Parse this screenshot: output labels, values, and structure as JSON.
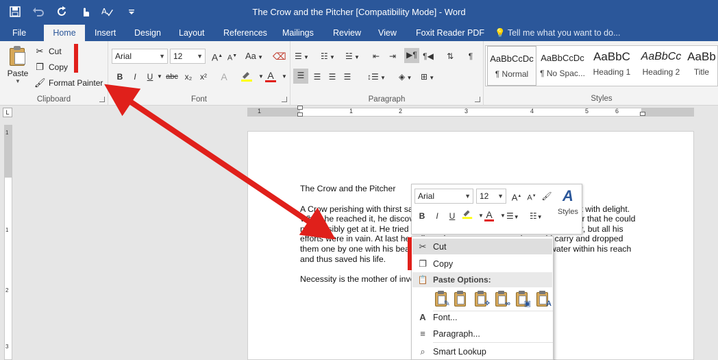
{
  "window": {
    "title": "The Crow and the Pitcher [Compatibility Mode] - Word"
  },
  "qat": {
    "save_icon": "save-icon",
    "undo_icon": "undo-icon",
    "redo_icon": "redo-icon",
    "touch_icon": "touch-mode-icon",
    "spelling_icon": "spelling-icon",
    "customize_icon": "customize-icon"
  },
  "tabs": [
    {
      "label": "File"
    },
    {
      "label": "Home"
    },
    {
      "label": "Insert"
    },
    {
      "label": "Design"
    },
    {
      "label": "Layout"
    },
    {
      "label": "References"
    },
    {
      "label": "Mailings"
    },
    {
      "label": "Review"
    },
    {
      "label": "View"
    },
    {
      "label": "Foxit Reader PDF"
    }
  ],
  "tell_me": "Tell me what you want to do...",
  "clipboard": {
    "paste": "Paste",
    "cut": "Cut",
    "copy": "Copy",
    "format_painter": "Format Painter",
    "label": "Clipboard"
  },
  "font": {
    "name": "Arial",
    "size": "12",
    "grow": "A",
    "shrink": "A",
    "case": "Aa",
    "bold": "B",
    "italic": "I",
    "underline": "U",
    "strike": "abc",
    "subscript": "x₂",
    "superscript": "x²",
    "effects": "A",
    "font_color": "A",
    "label": "Font"
  },
  "paragraph": {
    "label": "Paragraph",
    "pilcrow": "¶"
  },
  "styles": {
    "label": "Styles",
    "items": [
      {
        "preview": "AaBbCcDc",
        "name": "¶ Normal"
      },
      {
        "preview": "AaBbCcDc",
        "name": "¶ No Spac..."
      },
      {
        "preview": "AaBbC",
        "name": "Heading 1"
      },
      {
        "preview": "AaBbCc",
        "name": "Heading 2"
      },
      {
        "preview": "AaBb",
        "name": "Title"
      }
    ]
  },
  "ruler": {
    "numbers": [
      "1",
      "1",
      "2",
      "3",
      "4",
      "5",
      "6"
    ],
    "vnumbers": [
      "1",
      "1",
      "2",
      "3"
    ]
  },
  "document": {
    "title": "The Crow and the Pitcher",
    "para1": "A Crow perishing with thirst saw a pitcher, and hoping to find water, flew to it with delight. When he reached it, he discovered to his grief that it contained so little water that he could not possibly get at it. He tried everything he could think of to reach the water, but all his efforts were in vain. At last he collected as many stones as he could carry and dropped them one by one with his beak into the pitcher, until he brought the water within his reach and thus saved his life.",
    "para2": "Necessity is the mother of invention."
  },
  "minibar": {
    "font": "Arial",
    "size": "12",
    "grow": "A",
    "shrink": "A",
    "bold": "B",
    "italic": "I",
    "underline": "U",
    "styles": "Styles"
  },
  "context_menu": {
    "cut": "Cut",
    "copy": "Copy",
    "paste_options": "Paste Options:",
    "font": "Font...",
    "paragraph": "Paragraph...",
    "smart_lookup": "Smart Lookup"
  },
  "colors": {
    "accent": "#2b579a",
    "arrow": "#e0201b"
  }
}
